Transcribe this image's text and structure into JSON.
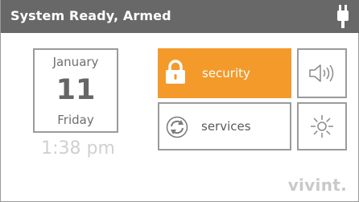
{
  "status_bar": {
    "status_text": "System Ready, Armed",
    "power_icon": "plug-icon"
  },
  "calendar": {
    "month": "January",
    "day": "11",
    "weekday": "Friday"
  },
  "clock": {
    "time": "1:38 pm"
  },
  "tiles": {
    "security": {
      "label": "security",
      "icon": "lock-icon",
      "color": "#f39a2b"
    },
    "services": {
      "label": "services",
      "icon": "refresh-icon"
    }
  },
  "quick_controls": {
    "volume_icon": "speaker-icon",
    "brightness_icon": "sun-icon"
  },
  "brand": {
    "name": "vivint."
  },
  "colors": {
    "topbar": "#686868",
    "accent": "#f39a2b",
    "border": "#9b9b9b"
  }
}
